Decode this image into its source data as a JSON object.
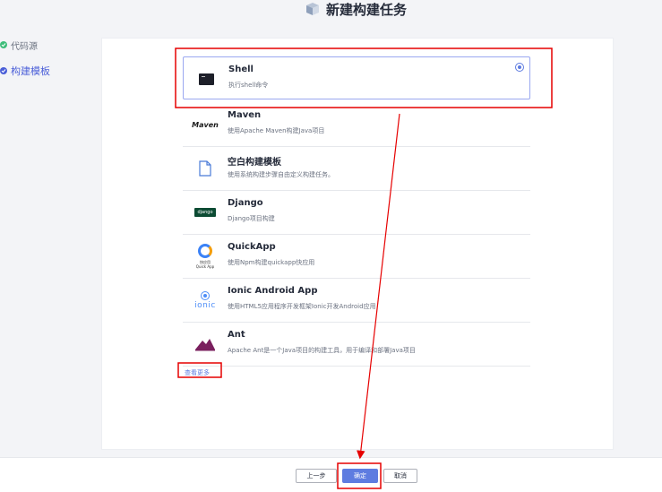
{
  "header": {
    "title": "新建构建任务",
    "logo_icon": "cube-icon"
  },
  "sidebar": {
    "steps": [
      {
        "label": "代码源",
        "status": "done"
      },
      {
        "label": "构建模板",
        "status": "current"
      }
    ]
  },
  "templates": [
    {
      "name": "Shell",
      "desc": "执行shell命令",
      "icon": "terminal-icon",
      "selected": true
    },
    {
      "name": "Maven",
      "desc": "使用Apache Maven构建Java项目",
      "icon": "maven-icon",
      "logo_text": "Maven"
    },
    {
      "name": "空白构建模板",
      "desc": "使用系统构建步骤自由定义构建任务。",
      "icon": "blank-document-icon"
    },
    {
      "name": "Django",
      "desc": "Django项目构建",
      "icon": "django-icon",
      "logo_text": "django"
    },
    {
      "name": "QuickApp",
      "desc": "使用Npm构建quickapp快应用",
      "icon": "quickapp-icon",
      "logo_text": "快应用\nQuick App"
    },
    {
      "name": "Ionic Android App",
      "desc": "使用HTML5应用程序开发框架Ionic开发Android应用",
      "icon": "ionic-icon",
      "logo_text": "ionic"
    },
    {
      "name": "Ant",
      "desc": "Apache Ant是一个Java项目的构建工具，用于编译和部署Java项目",
      "icon": "ant-icon"
    }
  ],
  "more_link": "查看更多",
  "footer": {
    "prev_label": "上一步",
    "confirm_label": "确定",
    "cancel_label": "取消"
  },
  "colors": {
    "accent": "#5e7ce0",
    "annotation": "#e60000",
    "success": "#3ebd7a"
  }
}
